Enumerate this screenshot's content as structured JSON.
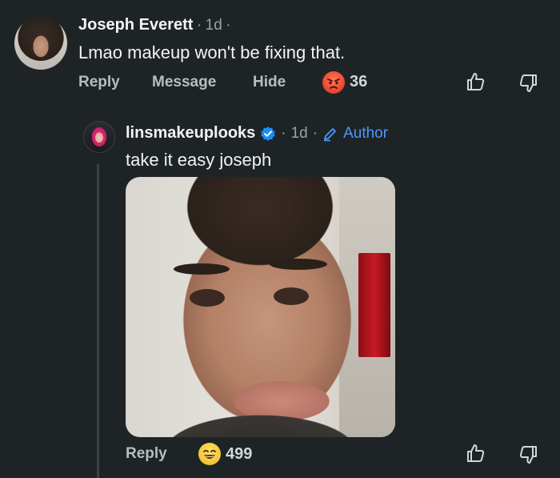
{
  "comment": {
    "author": "Joseph Everett",
    "time_sep": "·",
    "time": "1d",
    "trail": "·",
    "text": "Lmao makeup won't be fixing that.",
    "actions": {
      "reply": "Reply",
      "message": "Message",
      "hide": "Hide"
    },
    "reaction_count": "36",
    "reaction_icon": "angry-face-emoji"
  },
  "reply": {
    "author": "linsmakeuplooks",
    "verified_icon": "verified-badge-icon",
    "time_sep": "·",
    "time": "1d",
    "trail": "·",
    "author_badge": "Author",
    "text": "take it easy joseph",
    "actions": {
      "reply": "Reply"
    },
    "reaction_count": "499",
    "reaction_icon": "laughing-face-emoji"
  },
  "colors": {
    "background": "#1e2426",
    "accent_blue": "#4b97ff",
    "action_gray": "#b7bdc0"
  }
}
